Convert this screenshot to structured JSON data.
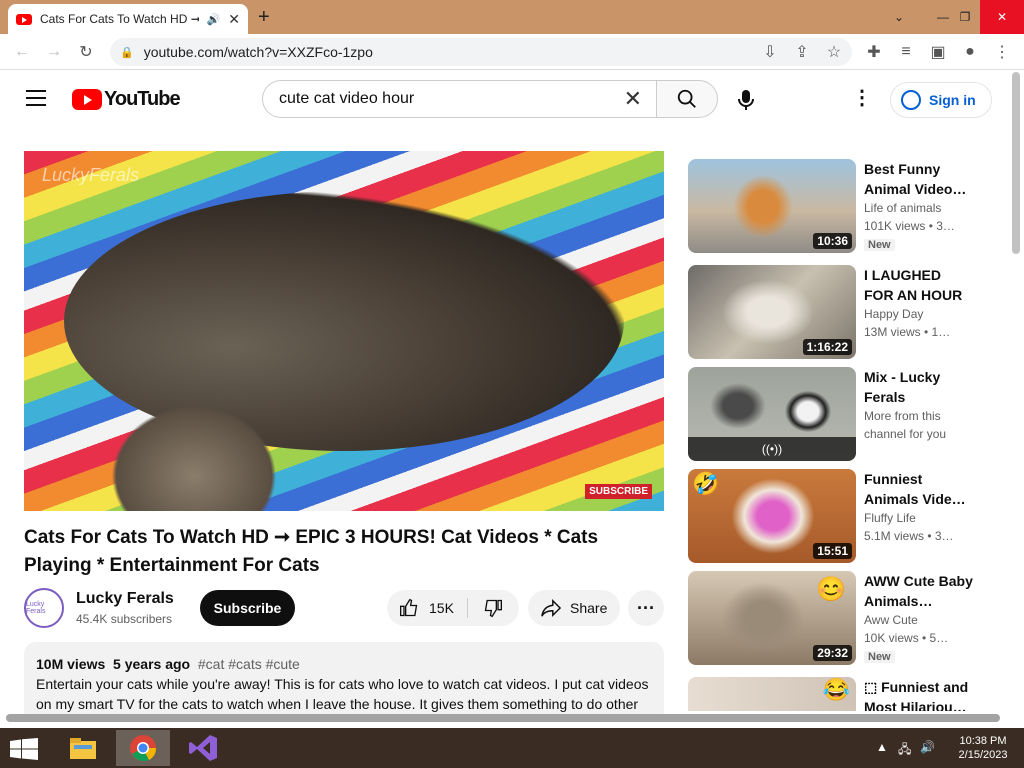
{
  "browser": {
    "tab_title": "Cats For Cats To Watch HD ➞",
    "url": "youtube.com/watch?v=XXZFco-1zpo"
  },
  "header": {
    "logo_text": "YouTube",
    "search_value": "cute cat video hour",
    "signin_label": "Sign in"
  },
  "player": {
    "watermark": "LuckyFerals",
    "subscribe_overlay": "SUBSCRIBE"
  },
  "video": {
    "title": "Cats For Cats To Watch HD ➞ EPIC 3 HOURS! Cat Videos * Cats Playing * Entertainment For Cats",
    "channel": "Lucky Ferals",
    "channel_avatar_text": "Lucky Ferals",
    "subscribers": "45.4K subscribers",
    "subscribe_label": "Subscribe",
    "likes": "15K",
    "share_label": "Share",
    "views": "10M views",
    "age": "5 years ago",
    "tags": "#cat #cats #cute",
    "description": "Entertain your cats while you're away! This is for cats who love to watch cat videos. I put cat videos on my smart TV for the cats to watch when I leave the house. It gives them something to do other"
  },
  "recommendations": [
    {
      "title": "Best Funny Animal Video…",
      "channel": "Life of animals",
      "meta": "101K views  • 3…",
      "badge": "New",
      "duration": "10:36"
    },
    {
      "title": "I LAUGHED FOR AN HOUR😹…",
      "channel": "Happy Day",
      "meta": "13M views  • 1…",
      "badge": "",
      "duration": "1:16:22"
    },
    {
      "title": "Mix - Lucky Ferals",
      "channel": "More from this",
      "meta": "channel for you",
      "badge": "",
      "duration": "((•))"
    },
    {
      "title": "Funniest Animals Vide…",
      "channel": "Fluffy Life",
      "meta": "5.1M views  • 3…",
      "badge": "",
      "duration": "15:51"
    },
    {
      "title": "AWW Cute Baby Animals…",
      "channel": "Aww Cute",
      "meta": "10K views  • 5…",
      "badge": "New",
      "duration": "29:32"
    },
    {
      "title": "⬚ Funniest and Most Hilariou…",
      "channel": "",
      "meta": "",
      "badge": "",
      "duration": ""
    }
  ],
  "taskbar": {
    "time": "10:38 PM",
    "date": "2/15/2023"
  },
  "colors": {
    "youtube_red": "#ff0000",
    "link_blue": "#065fd4",
    "title_bar": "#c89468",
    "taskbar": "#3a2c22"
  }
}
